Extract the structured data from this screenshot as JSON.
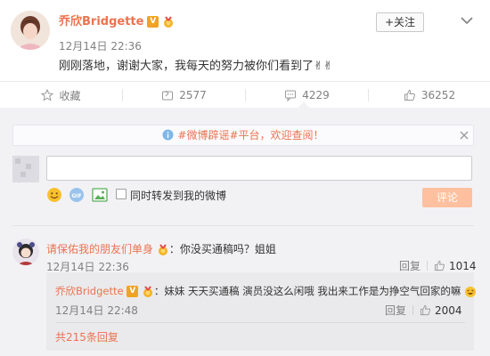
{
  "post": {
    "author": "乔欣Bridgette",
    "verified_badge": "V",
    "time": "12月14日 22:36",
    "text": "刚刚落地，谢谢大家，我每天的努力被你们看到了✌✌",
    "follow_label": "+关注"
  },
  "actions": {
    "favorite_label": "收藏",
    "repost_count": "2577",
    "comment_count": "4229",
    "like_count": "36252"
  },
  "notice": {
    "link_text": "#微博辟谣#平台",
    "suffix": "，欢迎查阅！"
  },
  "composer": {
    "repost_option": "同时转发到我的微博",
    "submit_label": "评论"
  },
  "comments": [
    {
      "author": "请保佑我的朋友们单身",
      "text": "：你没买通稿吗？姐姐",
      "time": "12月14日 22:36",
      "reply_label": "回复",
      "likes": "1014"
    }
  ],
  "reply": {
    "author": "乔欣Bridgette",
    "text": "：妹妹 天天买通稿 演员没这么闲哦  我出来工作是为挣空气回家的嘛",
    "time": "12月14日 22:48",
    "reply_label": "回复",
    "likes": "2004",
    "total_replies": "共215条回复"
  },
  "colors": {
    "accent": "#eb7350",
    "muted": "#808080",
    "background_gray": "#f2f2f5"
  }
}
